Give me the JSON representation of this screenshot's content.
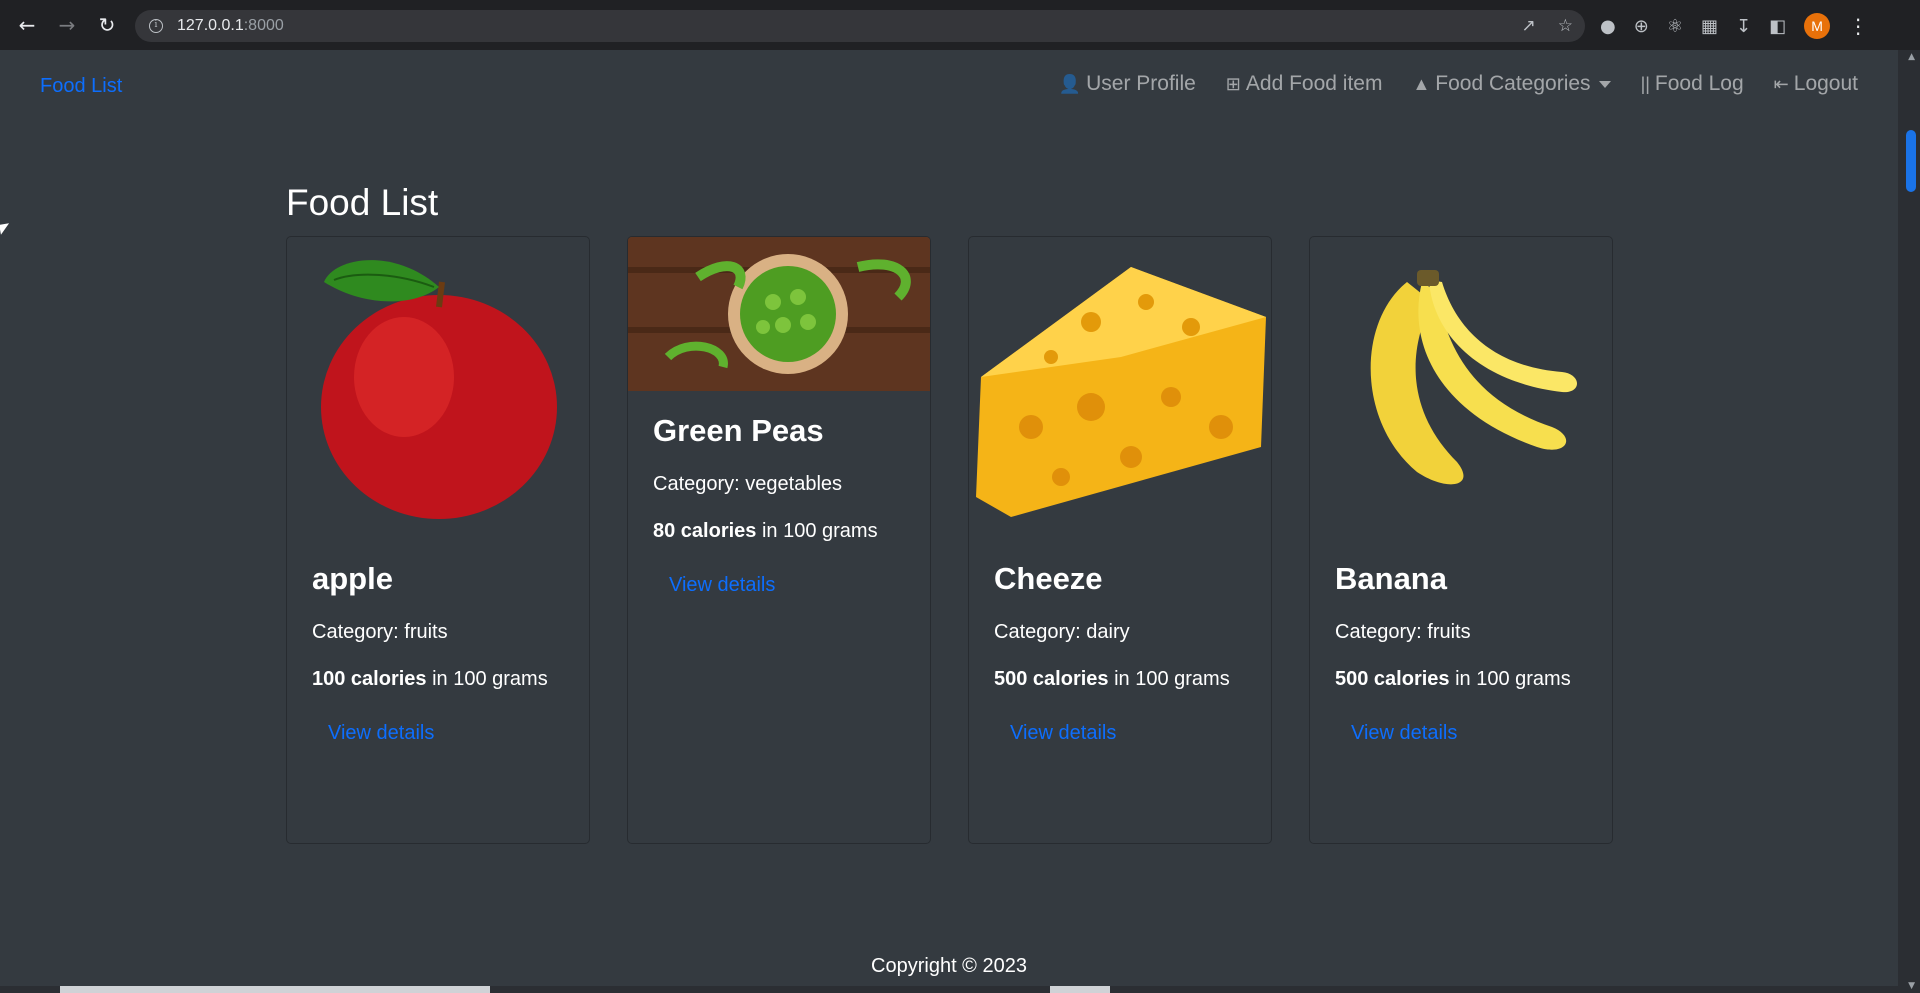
{
  "browser": {
    "url_host": "127.0.0.1",
    "url_port": ":8000",
    "avatar_letter": "M",
    "icons": [
      "back-arrow-icon",
      "forward-arrow-icon",
      "reload-icon",
      "share-icon",
      "star-icon",
      "extension-icon",
      "download-icon",
      "sidepanel-icon"
    ]
  },
  "navbar": {
    "brand": "Food List",
    "links": [
      {
        "label": "User Profile",
        "icon": "user-icon"
      },
      {
        "label": "Add Food item",
        "icon": "plus-square-icon"
      },
      {
        "label": "Food Categories",
        "icon": "pizza-icon"
      },
      {
        "label": "Food Log",
        "icon": "utensils-icon"
      },
      {
        "label": "Logout",
        "icon": "sign-out-icon"
      }
    ]
  },
  "page": {
    "title": "Food List",
    "cards": [
      {
        "name": "apple",
        "category": "Category: fruits",
        "calories": "100 calories",
        "calories_suffix": " in 100 grams",
        "link": "View details",
        "image": "apple"
      },
      {
        "name": "Green Peas",
        "category": "Category: vegetables",
        "calories": "80 calories",
        "calories_suffix": " in 100 grams",
        "link": "View details",
        "image": "green-peas"
      },
      {
        "name": "Cheeze",
        "category": "Category: dairy",
        "calories": "500 calories",
        "calories_suffix": " in 100 grams",
        "link": "View details",
        "image": "cheese"
      },
      {
        "name": "Banana",
        "category": "Category: fruits",
        "calories": "500 calories",
        "calories_suffix": " in 100 grams",
        "link": "View details",
        "image": "banana"
      }
    ],
    "footer": "Copyright © 2023"
  },
  "colors": {
    "page_bg": "#343a40",
    "link_blue": "#0d6efd",
    "chrome_bg": "#202124"
  }
}
